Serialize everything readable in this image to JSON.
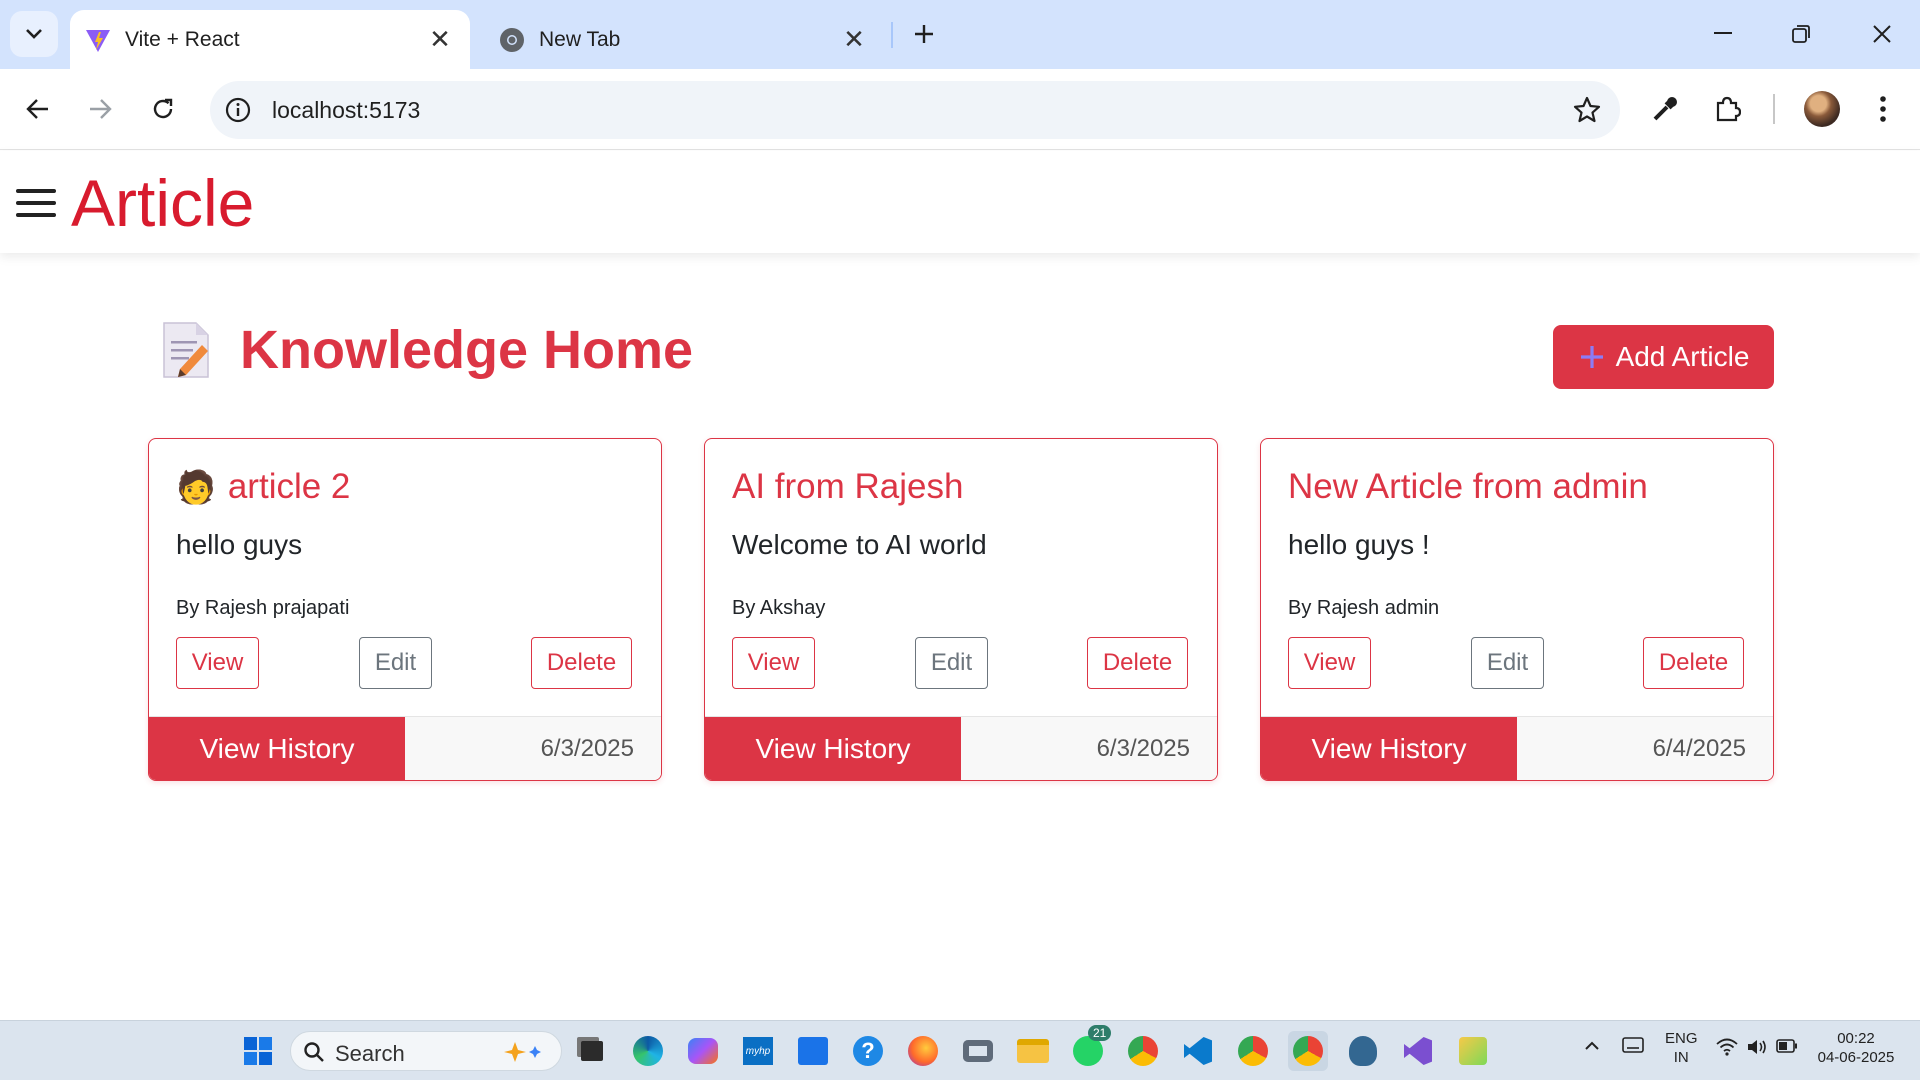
{
  "browser": {
    "tabs": [
      {
        "title": "Vite + React",
        "active": true
      },
      {
        "title": "New Tab",
        "active": false
      }
    ],
    "url": "localhost:5173"
  },
  "app": {
    "brand": "Article",
    "page_title": "Knowledge Home",
    "page_icon": "memo-icon",
    "add_button": "Add Article",
    "accent_color": "#dc3545",
    "articles": [
      {
        "title": "article 2",
        "emoji": "🧑",
        "description": "hello guys",
        "author": "By Rajesh prajapati",
        "view": "View",
        "edit": "Edit",
        "delete": "Delete",
        "history": "View History",
        "date": "6/3/2025"
      },
      {
        "title": "AI from Rajesh",
        "description": "Welcome to AI world",
        "author": "By Akshay",
        "view": "View",
        "edit": "Edit",
        "delete": "Delete",
        "history": "View History",
        "date": "6/3/2025"
      },
      {
        "title": "New Article from admin",
        "description": "hello guys !",
        "author": "By Rajesh admin",
        "view": "View",
        "edit": "Edit",
        "delete": "Delete",
        "history": "View History",
        "date": "6/4/2025"
      }
    ]
  },
  "taskbar": {
    "search_label": "Search",
    "whatsapp_badge": "21",
    "language": "ENG",
    "region": "IN",
    "time": "00:22",
    "date": "04-06-2025"
  }
}
